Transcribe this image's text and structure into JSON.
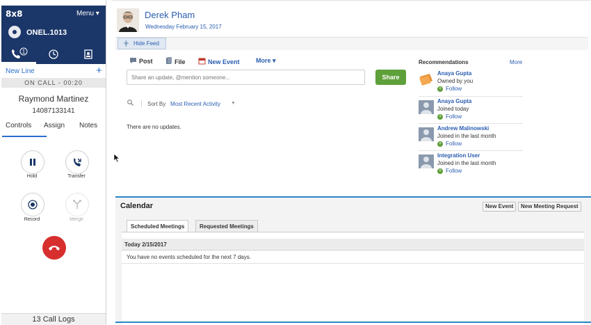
{
  "phone": {
    "brand": "8x8",
    "menu_label": "Menu ▾",
    "extension": "ONEL.1013",
    "tabs": [
      {
        "name": "calls",
        "icon": "phone-icon",
        "badge": "1"
      },
      {
        "name": "history",
        "icon": "clock-icon"
      },
      {
        "name": "contacts",
        "icon": "contacts-book-icon"
      }
    ],
    "new_line": "New Line",
    "add_symbol": "+",
    "status": "ON CALL - 00:20",
    "caller_name": "Raymond Martinez",
    "caller_number": "14087133141",
    "subtabs": [
      "Controls",
      "Assign",
      "Notes"
    ],
    "controls": {
      "hold": "Hold",
      "transfer": "Transfer",
      "record": "Record",
      "merge": "Merge"
    },
    "call_logs": "13 Call Logs",
    "colors": {
      "header": "#1b3668",
      "accent": "#2a6ecf",
      "hangup": "#d72e2e"
    }
  },
  "profile": {
    "name": "Derek Pham",
    "date": "Wednesday February 15, 2017"
  },
  "feed": {
    "hide_feed": "Hide Feed",
    "publisher_tabs": {
      "post": "Post",
      "file": "File",
      "new_event": "New Event",
      "more": "More ▾"
    },
    "input_placeholder": "Share an update, @mention someone...",
    "share": "Share",
    "sort_by": "Sort By",
    "sort_value": "Most Recent Activity",
    "empty": "There are no updates."
  },
  "recommendations": {
    "title": "Recommendations",
    "more": "More",
    "items": [
      {
        "name": "Anaya Gupta",
        "desc": "Owned by you",
        "follow": "Follow",
        "icon": "folder-stack-icon"
      },
      {
        "name": "Anaya Gupta",
        "desc": "Joined today",
        "follow": "Follow",
        "icon": "user-avatar-icon"
      },
      {
        "name": "Andrew Malinowski",
        "desc": "Joined in the last month",
        "follow": "Follow",
        "icon": "user-avatar-icon"
      },
      {
        "name": "Integration User",
        "desc": "Joined in the last month",
        "follow": "Follow",
        "icon": "user-avatar-icon"
      }
    ]
  },
  "calendar": {
    "title": "Calendar",
    "new_event": "New Event",
    "new_meeting_request": "New Meeting Request",
    "tabs": [
      "Scheduled Meetings",
      "Requested Meetings"
    ],
    "day": "Today 2/15/2017",
    "empty": "You have no events scheduled for the next 7 days."
  }
}
